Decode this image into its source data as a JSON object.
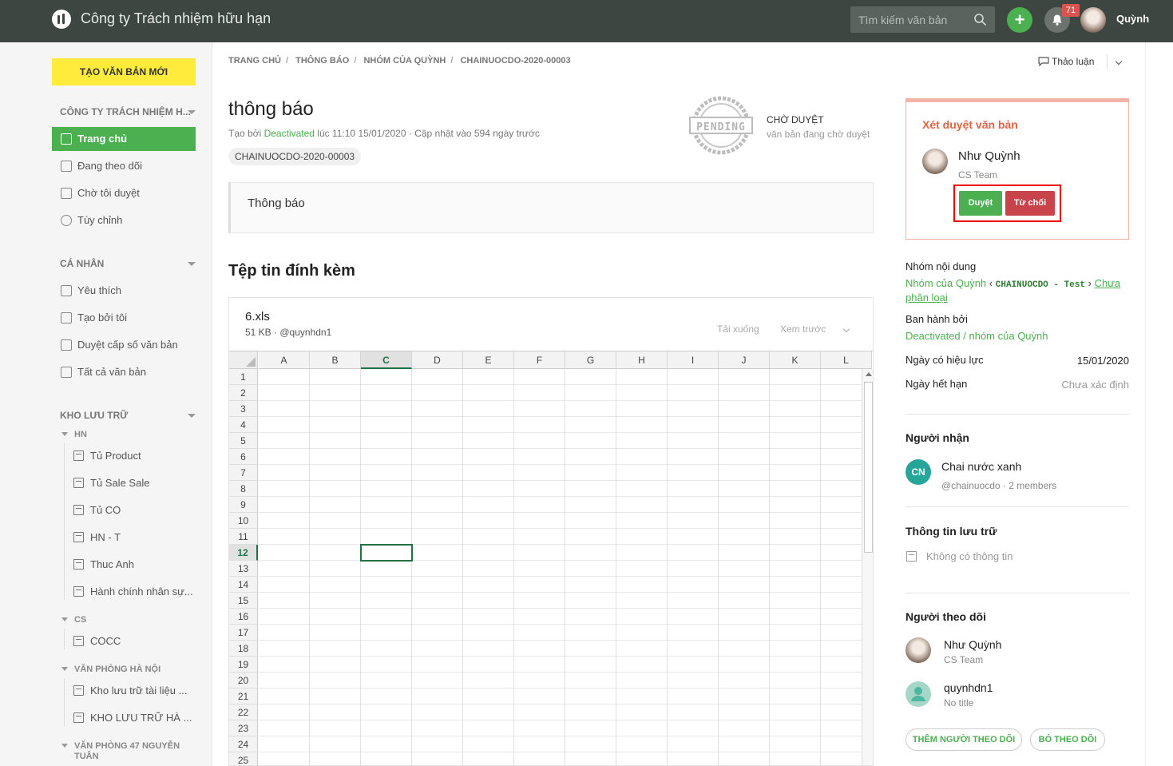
{
  "header": {
    "title": "Công ty Trách nhiệm hữu hạn",
    "search_placeholder": "Tìm kiếm văn bản",
    "add_label": "+",
    "notification_count": "71",
    "user_name": "Quỳnh"
  },
  "sidebar": {
    "new_doc_label": "TẠO VĂN BẢN MỚI",
    "company_section": "CÔNG TY TRÁCH NHIỆM H...",
    "company_items": [
      {
        "label": "Trang chủ",
        "icon": "home-icon",
        "active": true
      },
      {
        "label": "Đang theo dõi",
        "icon": "trend-icon"
      },
      {
        "label": "Chờ tôi duyệt",
        "icon": "clock-doc-icon"
      },
      {
        "label": "Tùy chỉnh",
        "icon": "gear-icon"
      }
    ],
    "personal_section": "CÁ NHÂN",
    "personal_items": [
      {
        "label": "Yêu thích",
        "icon": "favorite-icon"
      },
      {
        "label": "Tạo bởi tôi",
        "icon": "doc-icon"
      },
      {
        "label": "Duyệt cấp số văn bản",
        "icon": "copy-icon"
      },
      {
        "label": "Tất cả văn bản",
        "icon": "all-docs-icon"
      }
    ],
    "storage_section": "KHO LƯU TRỮ",
    "groups": [
      {
        "name": "HN",
        "folders": [
          "Tủ Product",
          "Tủ Sale Sale",
          "Tủ CO",
          "HN - T",
          "Thuc Anh",
          "Hành chính nhân sự..."
        ]
      },
      {
        "name": "CS",
        "folders": [
          "COCC"
        ]
      },
      {
        "name": "VĂN PHÒNG HÀ NỘI",
        "folders": [
          "Kho lưu trữ tài liệu ...",
          "KHO LƯU TRỮ HÀ ..."
        ]
      },
      {
        "name": "VĂN PHÒNG 47 NGUYỄN TUÂN",
        "folders": []
      }
    ]
  },
  "breadcrumb": [
    "TRANG CHỦ",
    "THÔNG BÁO",
    "NHÓM CỦA QUỲNH",
    "CHAINUOCDO-2020-00003"
  ],
  "discuss_label": "Thảo luận",
  "document": {
    "title": "thông báo",
    "meta_prefix": "Tạo bởi",
    "author": "Deactivated",
    "meta_suffix": "lúc 11:10 15/01/2020 · Cập nhật vào 594 ngày trước",
    "code": "CHAINUOCDO-2020-00003",
    "status": "CHỜ DUYỆT",
    "status_sub": "văn bản đang chờ duyệt",
    "stamp_text": "PENDING",
    "content": "Thông báo"
  },
  "attachments": {
    "title": "Tệp tin đính kèm",
    "file_name": "6.xls",
    "file_meta": "51 KB · @quynhdn1",
    "download_label": "Tải xuống",
    "preview_label": "Xem trước",
    "columns": [
      "A",
      "B",
      "C",
      "D",
      "E",
      "F",
      "G",
      "H",
      "I",
      "J",
      "K",
      "L"
    ],
    "rows": [
      "1",
      "2",
      "3",
      "4",
      "5",
      "6",
      "7",
      "8",
      "9",
      "10",
      "11",
      "12",
      "13",
      "14",
      "15",
      "16",
      "17",
      "18",
      "19",
      "20",
      "21",
      "22",
      "23",
      "24",
      "25"
    ],
    "selected_cell": "C12"
  },
  "approval": {
    "title": "Xét duyệt văn bản",
    "approver_name": "Như Quỳnh",
    "approver_team": "CS Team",
    "approve_label": "Duyệt",
    "reject_label": "Từ chối"
  },
  "details": {
    "content_group_label": "Nhóm nội dung",
    "content_group_a": "Nhóm của Quỳnh",
    "content_group_sep1": "‹",
    "content_group_b": "CHAINUOCDO - Test",
    "content_group_sep2": "›",
    "content_group_c": "Chưa phân loại",
    "issued_by_label": "Ban hành bởi",
    "issued_by": "Deactivated / nhóm của Quỳnh",
    "effective_label": "Ngày có hiệu lực",
    "effective": "15/01/2020",
    "expiry_label": "Ngày hết hạn",
    "expiry": "Chưa xác định"
  },
  "recipients": {
    "title": "Người nhận",
    "initials": "CN",
    "name": "Chai nước xanh",
    "sub": "@chainuocdo · 2 members"
  },
  "storage_info": {
    "title": "Thông tin lưu trữ",
    "text": "Không có thông tin"
  },
  "followers": {
    "title": "Người theo dõi",
    "items": [
      {
        "name": "Như Quỳnh",
        "sub": "CS Team"
      },
      {
        "name": "quynhdn1",
        "sub": "No title"
      }
    ],
    "add_label": "THÊM NGƯỜI THEO DÕI",
    "remove_label": "BỎ THEO DÕI"
  },
  "colors": {
    "topbar": "#3d4640",
    "accent": "#4caf50",
    "new_doc": "#ffeb3b",
    "reject": "#c9434a",
    "approve_title": "#e06446"
  }
}
